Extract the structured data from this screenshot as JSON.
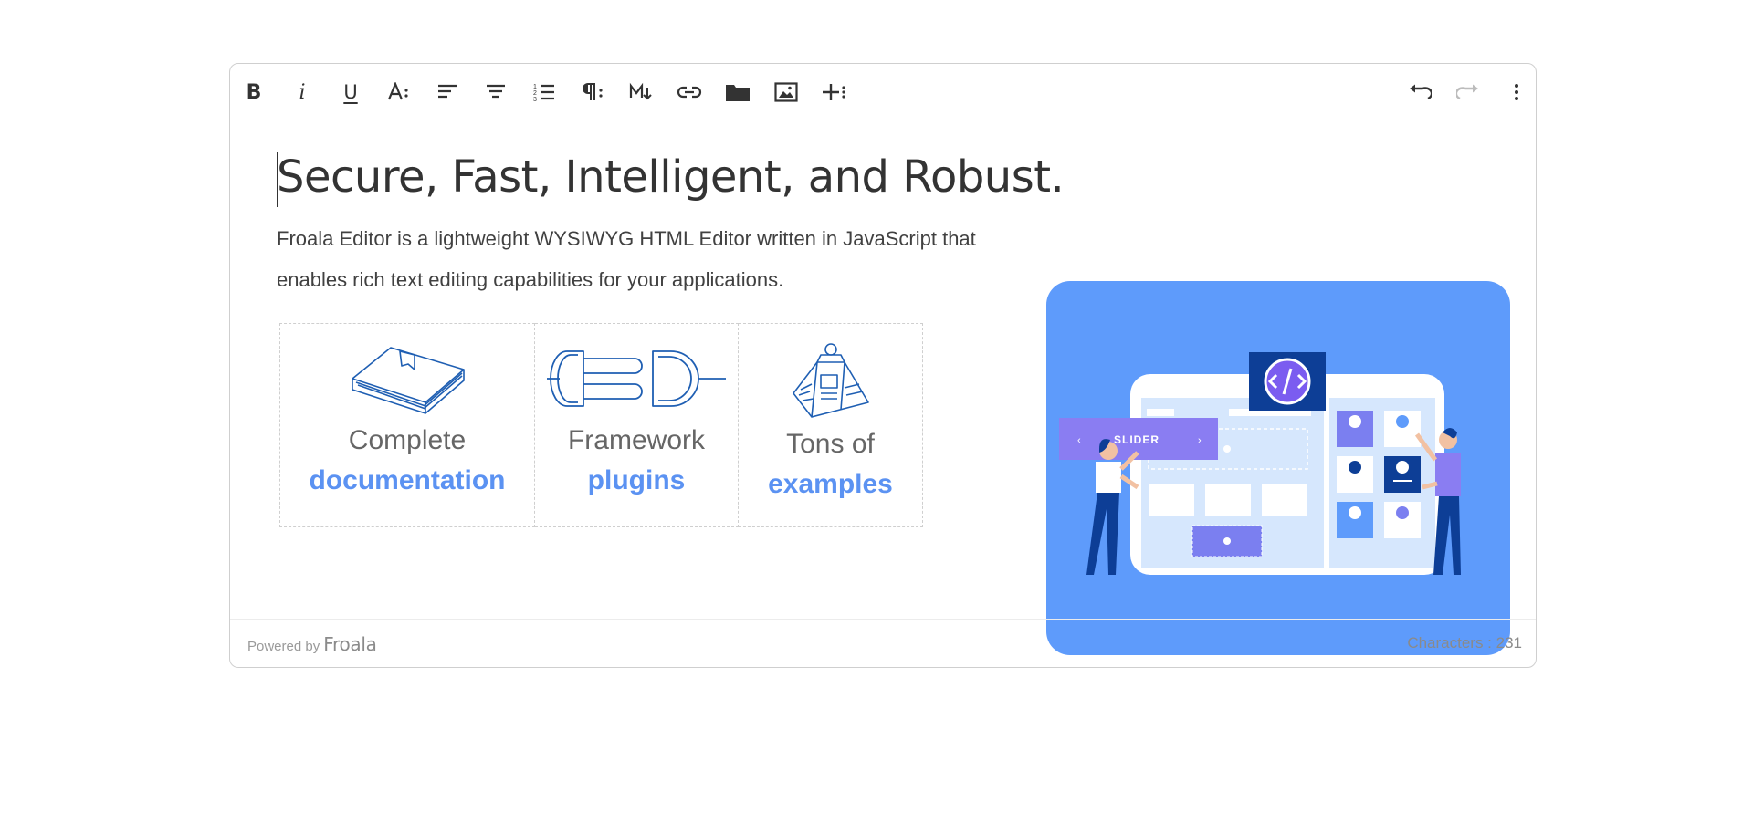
{
  "toolbar": {
    "bold": "B",
    "italic": "i",
    "underline": "U",
    "icons": [
      "bold-icon",
      "italic-icon",
      "underline-icon",
      "text-format-icon",
      "align-left-icon",
      "align-center-icon",
      "ordered-list-icon",
      "paragraph-format-icon",
      "markdown-icon",
      "link-icon",
      "folder-icon",
      "image-icon",
      "more-insert-icon",
      "undo-icon",
      "redo-icon",
      "more-vertical-icon"
    ],
    "redo_disabled": true
  },
  "content": {
    "heading": "Secure, Fast, Intelligent, and Robust.",
    "paragraph": "Froala Editor is a lightweight WYSIWYG HTML Editor written in JavaScript that enables rich text editing capabilities for your applications.",
    "features": [
      {
        "label": "Complete",
        "link": "documentation",
        "icon": "book-icon"
      },
      {
        "label": "Framework",
        "link": "plugins",
        "icon": "plug-icon"
      },
      {
        "label": "Tons of",
        "link": "examples",
        "icon": "newspaper-weight-icon"
      }
    ],
    "illustration": {
      "slider_label": "SLIDER",
      "bg_color": "#5e9bfb"
    }
  },
  "footer": {
    "powered_prefix": "Powered by",
    "powered_brand": "Froala",
    "characters": "Characters : 231"
  },
  "colors": {
    "accent_blue": "#5b92f2",
    "text": "#333333",
    "muted": "#8a8a8a"
  }
}
